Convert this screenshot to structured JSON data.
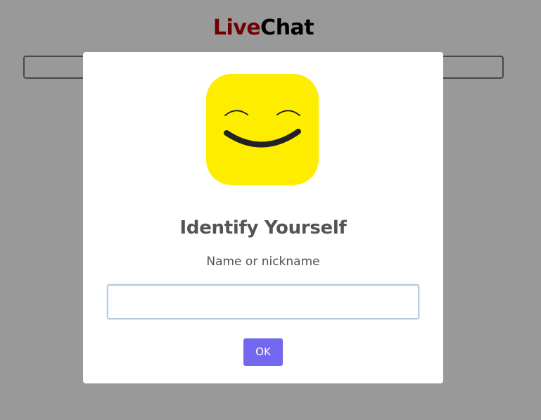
{
  "header": {
    "title_part1": "Live",
    "title_part2": "Chat"
  },
  "message_input": {
    "value": "",
    "placeholder": ""
  },
  "dialog": {
    "icon": "smiley-face-icon",
    "heading": "Identify Yourself",
    "label": "Name or nickname",
    "input_value": "",
    "ok_label": "OK"
  },
  "colors": {
    "title_accent": "#c00000",
    "title_dark": "#000000",
    "icon_background": "#ffed00",
    "button_background": "#7367f0",
    "overlay": "rgba(0,0,0,0.4)"
  }
}
